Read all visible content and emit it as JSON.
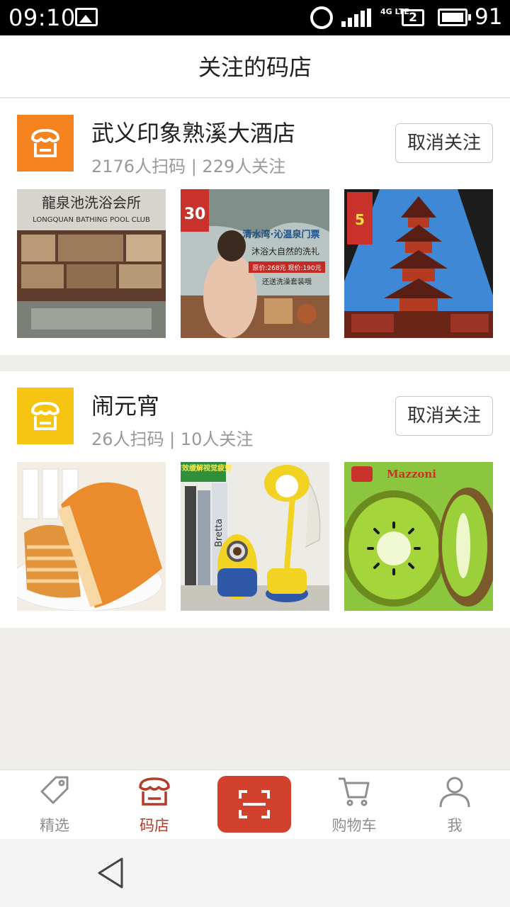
{
  "status_bar": {
    "time": "09:10",
    "network": "4G LTE",
    "sim": "2",
    "battery": "91"
  },
  "header": {
    "title": "关注的码店"
  },
  "stores": [
    {
      "name": "武义印象熟溪大酒店",
      "stats": "2176人扫码 | 229人关注",
      "logo_color": "#f5831f",
      "button": "取消关注",
      "thumbs": [
        {
          "label": "龍泉池洗浴会所",
          "sub": "LONGQUAN BATHING POOL CLUB"
        },
        {
          "badge": "30",
          "headline": "清水湾·沁温泉门票",
          "line": "沐浴大自然的洗礼",
          "price": "原价:268元  现价:190元",
          "extra": "还送洗澡套装哦"
        },
        {
          "badge": "5"
        }
      ]
    },
    {
      "name": "闹元宵",
      "stats": "26人扫码 | 10人关注",
      "logo_color": "#f6c413",
      "button": "取消关注",
      "thumbs": [
        {},
        {
          "tag": "有效缓解视觉疲劳",
          "book": "Bretta"
        },
        {
          "brand": "Mazzoni"
        }
      ]
    }
  ],
  "tabbar": {
    "items": [
      {
        "label": "精选",
        "icon": "tag-icon"
      },
      {
        "label": "码店",
        "icon": "store-icon",
        "active": true
      },
      {
        "label": "",
        "icon": "scan-icon"
      },
      {
        "label": "购物车",
        "icon": "cart-icon"
      },
      {
        "label": "我",
        "icon": "user-icon"
      }
    ],
    "active_color": "#b43c2a"
  }
}
